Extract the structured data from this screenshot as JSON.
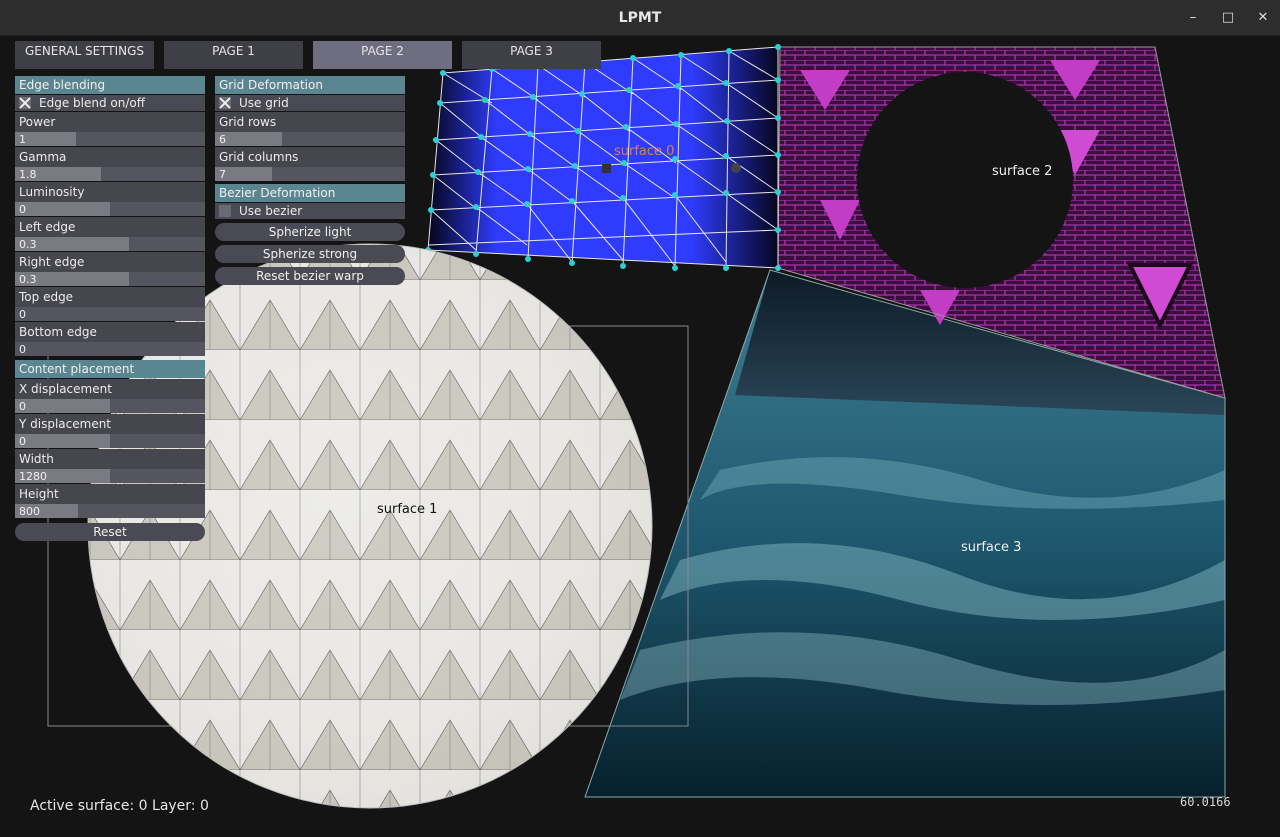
{
  "window": {
    "title": "LPMT",
    "minimize_icon": "minimize-icon",
    "maximize_icon": "maximize-icon",
    "close_icon": "close-icon"
  },
  "tabs": [
    {
      "label": "GENERAL SETTINGS",
      "active": false
    },
    {
      "label": "PAGE 1",
      "active": false
    },
    {
      "label": "PAGE 2",
      "active": true
    },
    {
      "label": "PAGE 3",
      "active": false
    }
  ],
  "edge": {
    "header": "Edge blending",
    "toggle": {
      "label": "Edge blend on/off",
      "checked": true
    },
    "sliders": [
      {
        "label": "Power",
        "value": "1",
        "fill": 0.32
      },
      {
        "label": "Gamma",
        "value": "1.8",
        "fill": 0.45
      },
      {
        "label": "Luminosity",
        "value": "0",
        "fill": 0.5
      },
      {
        "label": "Left edge",
        "value": "0.3",
        "fill": 0.6
      },
      {
        "label": "Right edge",
        "value": "0.3",
        "fill": 0.6
      },
      {
        "label": "Top edge",
        "value": "0",
        "fill": 0.0
      },
      {
        "label": "Bottom edge",
        "value": "0",
        "fill": 0.0
      }
    ]
  },
  "content": {
    "header": "Content placement",
    "sliders": [
      {
        "label": "X displacement",
        "value": "0",
        "fill": 0.5
      },
      {
        "label": "Y displacement",
        "value": "0",
        "fill": 0.5
      },
      {
        "label": "Width",
        "value": "1280",
        "fill": 0.5
      },
      {
        "label": "Height",
        "value": "800",
        "fill": 0.33
      }
    ],
    "reset_label": "Reset"
  },
  "grid": {
    "header": "Grid Deformation",
    "toggle": {
      "label": "Use grid",
      "checked": true
    },
    "sliders": [
      {
        "label": "Grid rows",
        "value": "6",
        "fill": 0.35
      },
      {
        "label": "Grid columns",
        "value": "7",
        "fill": 0.3
      }
    ]
  },
  "bezier": {
    "header": "Bezier Deformation",
    "toggle": {
      "label": "Use bezier",
      "checked": false
    },
    "buttons": [
      "Spherize light",
      "Spherize strong",
      "Reset bezier warp"
    ]
  },
  "surfaces": [
    "surface 0",
    "surface 1",
    "surface 2",
    "surface 3"
  ],
  "status": "Active surface: 0 Layer: 0",
  "fps": "60.0166",
  "colors": {
    "accent": "#5b8590",
    "grid_blue": "#2f3cff",
    "magenta": "#c23cc6",
    "sea": "#1e4a5c"
  }
}
